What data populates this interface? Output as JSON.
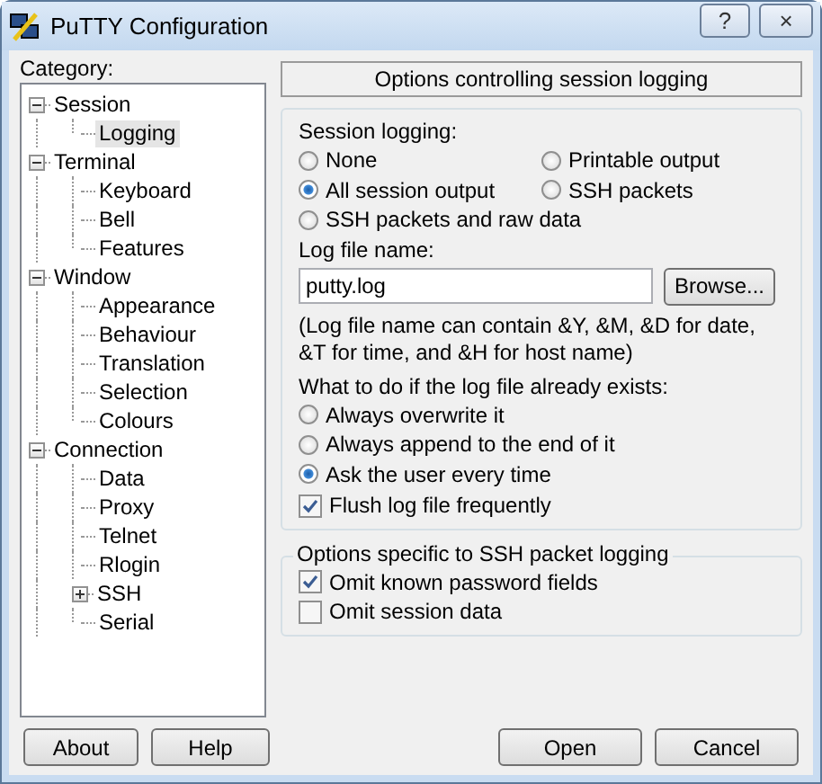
{
  "window": {
    "title": "PuTTY Configuration",
    "help_button": "?",
    "close_button": "×"
  },
  "category": {
    "label": "Category:",
    "tree": [
      {
        "label": "Session",
        "expanded": true,
        "selected": false,
        "children": [
          {
            "label": "Logging",
            "selected": true
          }
        ]
      },
      {
        "label": "Terminal",
        "expanded": true,
        "selected": false,
        "children": [
          {
            "label": "Keyboard",
            "selected": false
          },
          {
            "label": "Bell",
            "selected": false
          },
          {
            "label": "Features",
            "selected": false
          }
        ]
      },
      {
        "label": "Window",
        "expanded": true,
        "selected": false,
        "children": [
          {
            "label": "Appearance",
            "selected": false
          },
          {
            "label": "Behaviour",
            "selected": false
          },
          {
            "label": "Translation",
            "selected": false
          },
          {
            "label": "Selection",
            "selected": false
          },
          {
            "label": "Colours",
            "selected": false
          }
        ]
      },
      {
        "label": "Connection",
        "expanded": true,
        "selected": false,
        "children": [
          {
            "label": "Data",
            "selected": false
          },
          {
            "label": "Proxy",
            "selected": false
          },
          {
            "label": "Telnet",
            "selected": false
          },
          {
            "label": "Rlogin",
            "selected": false
          },
          {
            "label": "SSH",
            "expanded": false,
            "selected": false
          },
          {
            "label": "Serial",
            "selected": false
          }
        ]
      }
    ]
  },
  "panel_header": "Options controlling session logging",
  "logging_group": {
    "session_logging": {
      "label": "Session logging:",
      "options": [
        {
          "label": "None",
          "selected": false
        },
        {
          "label": "Printable output",
          "selected": false
        },
        {
          "label": "All session output",
          "selected": true
        },
        {
          "label": "SSH packets",
          "selected": false
        },
        {
          "label": "SSH packets and raw data",
          "selected": false
        }
      ]
    },
    "log_file": {
      "label": "Log file name:",
      "value": "putty.log",
      "browse_button": "Browse..."
    },
    "note": "(Log file name can contain &Y, &M, &D for date, &T for time, and &H for host name)",
    "exists": {
      "label": "What to do if the log file already exists:",
      "options": [
        {
          "label": "Always overwrite it",
          "selected": false
        },
        {
          "label": "Always append to the end of it",
          "selected": false
        },
        {
          "label": "Ask the user every time",
          "selected": true
        }
      ]
    },
    "flush": {
      "label": "Flush log file frequently",
      "checked": true
    }
  },
  "ssh_group": {
    "title": "Options specific to SSH packet logging",
    "options": [
      {
        "label": "Omit known password fields",
        "checked": true
      },
      {
        "label": "Omit session data",
        "checked": false
      }
    ]
  },
  "buttons": {
    "left": [
      "About",
      "Help"
    ],
    "right": [
      "Open",
      "Cancel"
    ]
  }
}
